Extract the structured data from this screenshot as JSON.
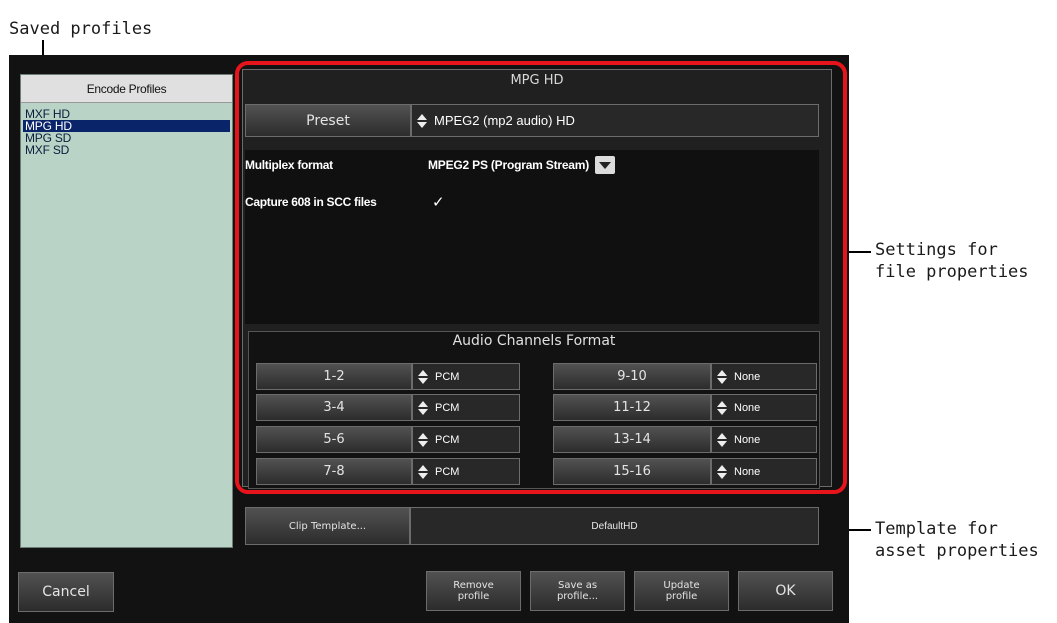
{
  "annotations": {
    "saved_profiles": "Saved profiles",
    "settings_for_file_properties": "Settings for\nfile properties",
    "template_for_asset_properties": "Template for\nasset properties"
  },
  "profiles": {
    "header": "Encode Profiles",
    "items": [
      {
        "label": "MXF HD",
        "selected": false
      },
      {
        "label": "MPG HD",
        "selected": true
      },
      {
        "label": "MPG SD",
        "selected": false
      },
      {
        "label": "MXF SD",
        "selected": false
      }
    ]
  },
  "settings": {
    "title": "MPG HD",
    "preset_button": "Preset",
    "preset_value": "MPEG2 (mp2 audio) HD",
    "multiplex_label": "Multiplex format",
    "multiplex_value": "MPEG2 PS (Program Stream)",
    "capture_label": "Capture 608 in SCC files",
    "capture_checked": true,
    "capture_glyph": "✓"
  },
  "audio": {
    "title": "Audio Channels Format",
    "channels": [
      {
        "label": "1-2",
        "value": "PCM"
      },
      {
        "label": "3-4",
        "value": "PCM"
      },
      {
        "label": "5-6",
        "value": "PCM"
      },
      {
        "label": "7-8",
        "value": "PCM"
      },
      {
        "label": "9-10",
        "value": "None"
      },
      {
        "label": "11-12",
        "value": "None"
      },
      {
        "label": "13-14",
        "value": "None"
      },
      {
        "label": "15-16",
        "value": "None"
      }
    ]
  },
  "template": {
    "button": "Clip Template...",
    "value": "DefaultHD"
  },
  "buttons": {
    "cancel": "Cancel",
    "remove_profile": "Remove\nprofile",
    "save_as_profile": "Save as\nprofile...",
    "update_profile": "Update\nprofile",
    "ok": "OK"
  },
  "colors": {
    "highlight_border": "#e8141c",
    "selection": "#0a246a",
    "profile_list_bg": "#b9d3c6"
  }
}
